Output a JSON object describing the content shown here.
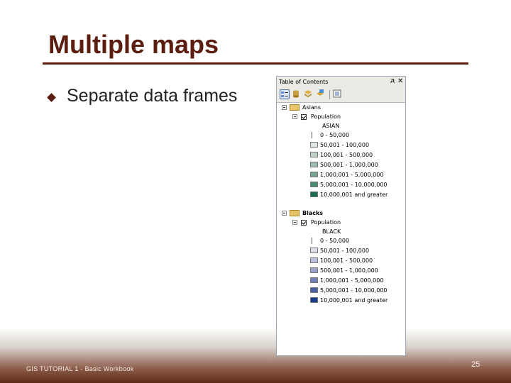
{
  "slide": {
    "title": "Multiple maps",
    "bullet": "Separate data frames",
    "footer": "GIS TUTORIAL 1 - Basic Workbook",
    "page_number": "25"
  },
  "toc": {
    "title": "Table of Contents",
    "pin_glyph": "д",
    "close_glyph": "✕",
    "toolbar_icons": [
      "list-by-drawing-order-icon",
      "list-by-source-icon",
      "list-by-visibility-icon",
      "list-by-selection-icon",
      "options-icon"
    ],
    "frames": [
      {
        "name": "Asians",
        "layer": "Population",
        "field": "ASIAN",
        "classes": [
          {
            "label": "0 - 50,000",
            "color": "#ffffff"
          },
          {
            "label": "50,001 - 100,000",
            "color": "#dde8e2"
          },
          {
            "label": "100,001 - 500,000",
            "color": "#bcd3c6"
          },
          {
            "label": "500,001 - 1,000,000",
            "color": "#9bbfac"
          },
          {
            "label": "1,000,001 - 5,000,000",
            "color": "#76a68f"
          },
          {
            "label": "5,000,001 - 10,000,000",
            "color": "#4a8b70"
          },
          {
            "label": "10,000,001 and greater",
            "color": "#1a6e4e"
          }
        ]
      },
      {
        "name": "Blacks",
        "layer": "Population",
        "field": "BLACK",
        "classes": [
          {
            "label": "0 - 50,000",
            "color": "#ffffff"
          },
          {
            "label": "50,001 - 100,000",
            "color": "#dde0ec"
          },
          {
            "label": "100,001 - 500,000",
            "color": "#bcc2dd"
          },
          {
            "label": "500,001 - 1,000,000",
            "color": "#99a3cb"
          },
          {
            "label": "1,000,001 - 5,000,000",
            "color": "#7481b7"
          },
          {
            "label": "5,000,001 - 10,000,000",
            "color": "#4c5fa2"
          },
          {
            "label": "10,000,001 and greater",
            "color": "#173c8a"
          }
        ]
      }
    ]
  }
}
